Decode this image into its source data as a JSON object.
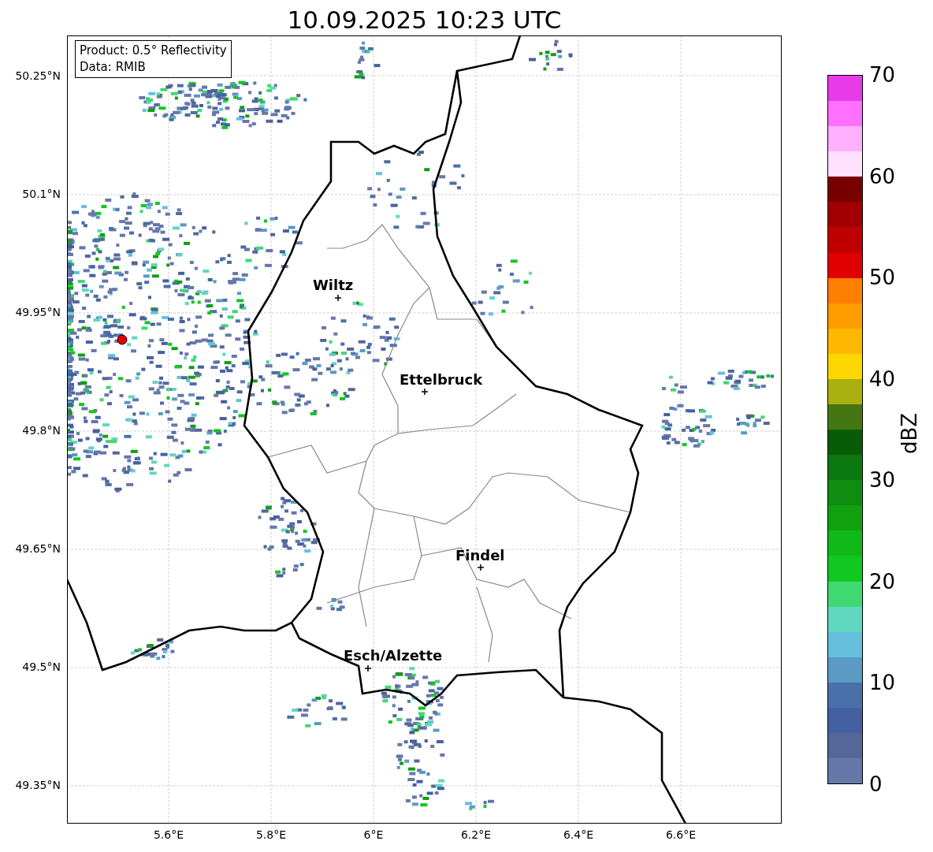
{
  "title": "10.09.2025 10:23 UTC",
  "info_box": {
    "lines": [
      "Product: 0.5° Reflectivity",
      "Data: RMIB"
    ]
  },
  "map": {
    "y_ticks": [
      "50.25°N",
      "50.1°N",
      "49.95°N",
      "49.8°N",
      "49.65°N",
      "49.5°N",
      "49.35°N"
    ],
    "x_ticks": [
      "5.6°E",
      "5.8°E",
      "6°E",
      "6.2°E",
      "6.4°E",
      "6.6°E"
    ],
    "places": [
      {
        "name": "Wiltz"
      },
      {
        "name": "Ettelbruck"
      },
      {
        "name": "Findel"
      },
      {
        "name": "Esch/Alzette"
      }
    ]
  },
  "colorbar": {
    "label": "dBZ",
    "ticks": [
      "70",
      "60",
      "50",
      "40",
      "30",
      "20",
      "10",
      "0"
    ],
    "levels": [
      {
        "color": "#e83ae8"
      },
      {
        "color": "#ff70ff"
      },
      {
        "color": "#ffb0ff"
      },
      {
        "color": "#ffe0ff"
      },
      {
        "color": "#780000"
      },
      {
        "color": "#a00000"
      },
      {
        "color": "#c00000"
      },
      {
        "color": "#e00000"
      },
      {
        "color": "#ff7f00"
      },
      {
        "color": "#ff9c00"
      },
      {
        "color": "#ffb800"
      },
      {
        "color": "#ffd700"
      },
      {
        "color": "#aab010"
      },
      {
        "color": "#447711"
      },
      {
        "color": "#085c08"
      },
      {
        "color": "#0c7810"
      },
      {
        "color": "#108c10"
      },
      {
        "color": "#10a010"
      },
      {
        "color": "#10b818"
      },
      {
        "color": "#10c820"
      },
      {
        "color": "#40d870"
      },
      {
        "color": "#60d8c0"
      },
      {
        "color": "#66c0dd"
      },
      {
        "color": "#5a9ac5"
      },
      {
        "color": "#4a70aa"
      },
      {
        "color": "#4460a0"
      },
      {
        "color": "#556699"
      },
      {
        "color": "#6677aa"
      }
    ]
  }
}
